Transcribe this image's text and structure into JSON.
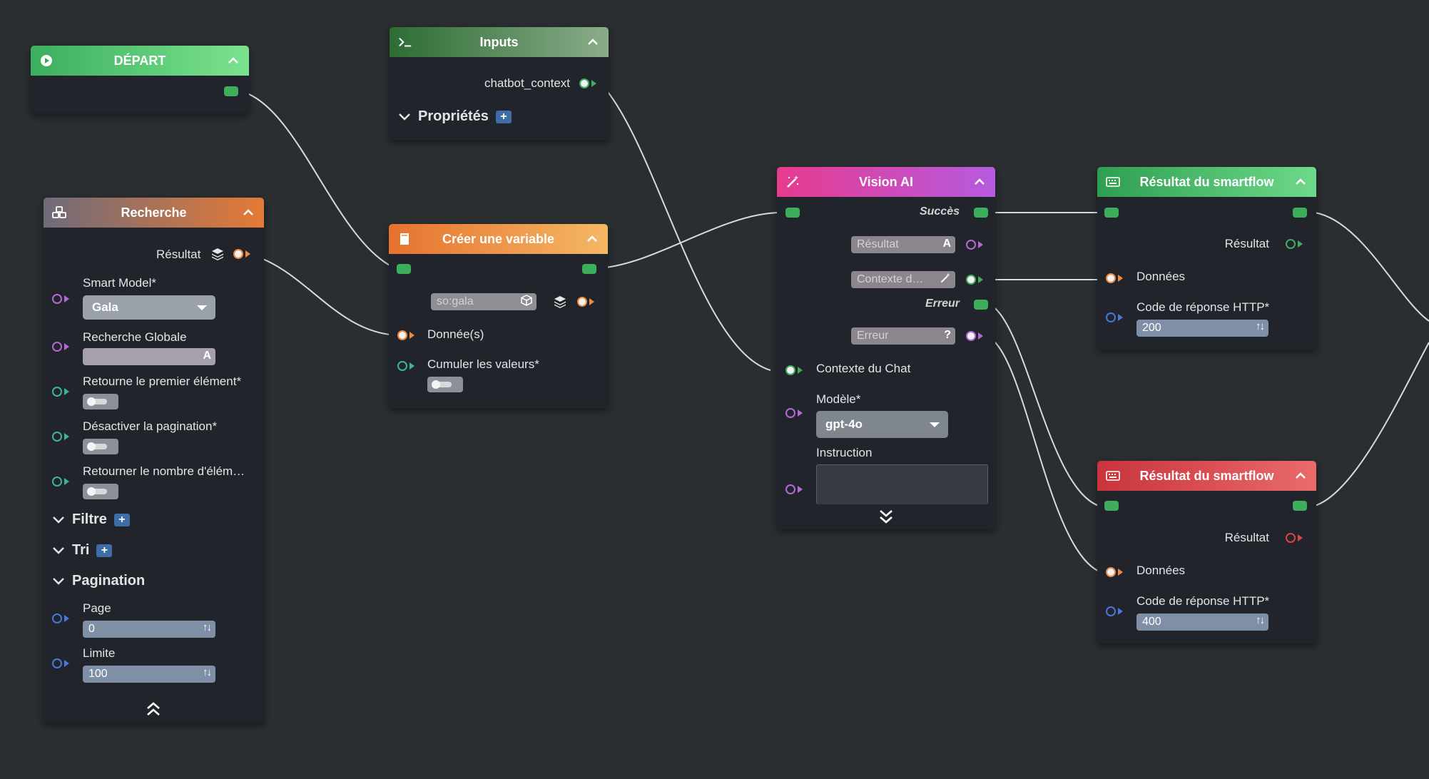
{
  "colors": {
    "background": "#2a2e31",
    "node_body": "#21252b",
    "flow_port": "#3fae5c",
    "wire": "#d8dadc",
    "depart_header": "#5ec97a",
    "inputs_header": "#3d7a45",
    "recherche_header": "#e07b3c",
    "variable_header": "#ef8a3f",
    "vision_header": "#e43b93",
    "result_success_header": "#4bbf6a",
    "result_error_header": "#d9444a"
  },
  "depart": {
    "title": "DÉPART",
    "icon": "play-circle-icon"
  },
  "inputs": {
    "title": "Inputs",
    "icon": "terminal-icon",
    "output_label": "chatbot_context",
    "section_label": "Propriétés",
    "plus": "+"
  },
  "recherche": {
    "title": "Recherche",
    "icon": "boxes-icon",
    "result_label": "Résultat",
    "smart_model_label": "Smart Model*",
    "smart_model_value": "Gala",
    "global_search_label": "Recherche Globale",
    "first_element_label": "Retourne le premier élément*",
    "disable_pagination_label": "Désactiver la pagination*",
    "count_label": "Retourner le nombre d'élém…",
    "filter_label": "Filtre",
    "sort_label": "Tri",
    "pagination_label": "Pagination",
    "page_label": "Page",
    "page_value": "0",
    "limit_label": "Limite",
    "limit_value": "100",
    "plus": "+"
  },
  "variable": {
    "title": "Créer une variable",
    "icon": "note-icon",
    "name_value": "so:gala",
    "data_label": "Donnée(s)",
    "accumulate_label": "Cumuler les valeurs*"
  },
  "vision": {
    "title": "Vision AI",
    "icon": "magic-wand-icon",
    "success_label": "Succès",
    "result_pill": "Résultat",
    "context_pill": "Contexte d…",
    "error_label": "Erreur",
    "error_pill": "Erreur",
    "chat_context_label": "Contexte du Chat",
    "model_label": "Modèle*",
    "model_value": "gpt-4o",
    "instruction_label": "Instruction"
  },
  "result_success": {
    "title": "Résultat du smartflow",
    "icon": "keyboard-icon",
    "result_label": "Résultat",
    "data_label": "Données",
    "http_label": "Code de réponse HTTP*",
    "http_value": "200"
  },
  "result_error": {
    "title": "Résultat du smartflow",
    "icon": "keyboard-icon",
    "result_label": "Résultat",
    "data_label": "Données",
    "http_label": "Code de réponse HTTP*",
    "http_value": "400"
  }
}
